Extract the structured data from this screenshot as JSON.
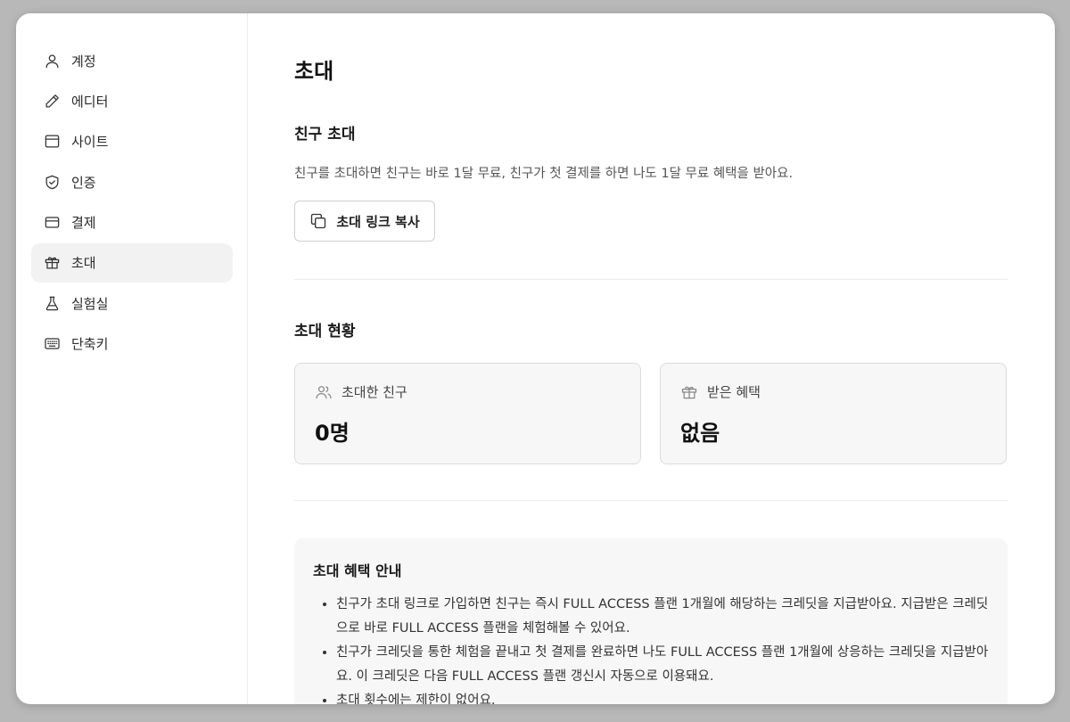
{
  "sidebar": {
    "items": [
      {
        "label": "계정",
        "icon": "user-icon"
      },
      {
        "label": "에디터",
        "icon": "pencil-icon"
      },
      {
        "label": "사이트",
        "icon": "browser-icon"
      },
      {
        "label": "인증",
        "icon": "shield-check-icon"
      },
      {
        "label": "결제",
        "icon": "credit-card-icon"
      },
      {
        "label": "초대",
        "icon": "gift-icon",
        "active": true
      },
      {
        "label": "실험실",
        "icon": "flask-icon"
      },
      {
        "label": "단축키",
        "icon": "keyboard-icon"
      }
    ]
  },
  "main": {
    "title": "초대",
    "invite": {
      "title": "친구 초대",
      "description": "친구를 초대하면 친구는 바로 1달 무료, 친구가 첫 결제를 하면 나도 1달 무료 혜택을 받아요.",
      "copy_button_label": "초대 링크 복사"
    },
    "status": {
      "title": "초대 현황",
      "invited": {
        "label": "초대한 친구",
        "value": "0명"
      },
      "rewards": {
        "label": "받은 혜택",
        "value": "없음"
      }
    },
    "guide": {
      "title": "초대 혜택 안내",
      "items": [
        "친구가 초대 링크로 가입하면 친구는 즉시 FULL ACCESS 플랜 1개월에 해당하는 크레딧을 지급받아요. 지급받은 크레딧으로 바로 FULL ACCESS 플랜을 체험해볼 수 있어요.",
        "친구가 크레딧을 통한 체험을 끝내고 첫 결제를 완료하면 나도 FULL ACCESS 플랜 1개월에 상응하는 크레딧을 지급받아요. 이 크레딧은 다음 FULL ACCESS 플랜 갱신시 자동으로 이용돼요.",
        "초대 횟수에는 제한이 없어요."
      ]
    }
  },
  "colors": {
    "background": "#b8b8b8",
    "active_nav": "#f2f2f2",
    "card_bg": "#f7f7f7"
  }
}
